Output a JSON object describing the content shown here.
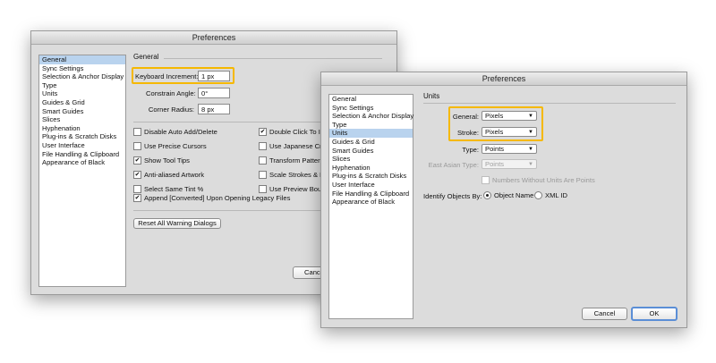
{
  "general_dialog": {
    "title": "Preferences",
    "categories": [
      "General",
      "Sync Settings",
      "Selection & Anchor Display",
      "Type",
      "Units",
      "Guides & Grid",
      "Smart Guides",
      "Slices",
      "Hyphenation",
      "Plug-ins & Scratch Disks",
      "User Interface",
      "File Handling & Clipboard",
      "Appearance of Black"
    ],
    "selected_category": "General",
    "section_title": "General",
    "keyboard_increment_label": "Keyboard Increment:",
    "keyboard_increment_value": "1 px",
    "constrain_angle_label": "Constrain Angle:",
    "constrain_angle_value": "0°",
    "corner_radius_label": "Corner Radius:",
    "corner_radius_value": "8 px",
    "options_left": [
      {
        "label": "Disable Auto Add/Delete",
        "checked": false
      },
      {
        "label": "Use Precise Cursors",
        "checked": false
      },
      {
        "label": "Show Tool Tips",
        "checked": true
      },
      {
        "label": "Anti-aliased Artwork",
        "checked": true
      },
      {
        "label": "Select Same Tint %",
        "checked": false
      }
    ],
    "options_right": [
      {
        "label": "Double Click To Is",
        "checked": true
      },
      {
        "label": "Use Japanese Crop",
        "checked": false
      },
      {
        "label": "Transform Pattern",
        "checked": false
      },
      {
        "label": "Scale Strokes & Ef",
        "checked": false
      },
      {
        "label": "Use Preview Bound",
        "checked": false
      }
    ],
    "append_option": {
      "label": "Append [Converted] Upon Opening Legacy Files",
      "checked": true
    },
    "reset_button": "Reset All Warning Dialogs",
    "cancel_button": "Cance"
  },
  "units_dialog": {
    "title": "Preferences",
    "categories": [
      "General",
      "Sync Settings",
      "Selection & Anchor Display",
      "Type",
      "Units",
      "Guides & Grid",
      "Smart Guides",
      "Slices",
      "Hyphenation",
      "Plug-ins & Scratch Disks",
      "User Interface",
      "File Handling & Clipboard",
      "Appearance of Black"
    ],
    "selected_category": "Units",
    "section_title": "Units",
    "general_label": "General:",
    "general_value": "Pixels",
    "stroke_label": "Stroke:",
    "stroke_value": "Pixels",
    "type_label": "Type:",
    "type_value": "Points",
    "east_asian_label": "East Asian Type:",
    "east_asian_value": "Points",
    "numbers_option": "Numbers Without Units Are Points",
    "identify_label": "Identify Objects By:",
    "radio_object_name": "Object Name",
    "radio_xml_id": "XML ID",
    "cancel_button": "Cancel",
    "ok_button": "OK"
  },
  "colors": {
    "highlight": "#f5b800",
    "selection": "#b9d3ee",
    "ok_border": "#5b8ed6"
  },
  "icons": {
    "check": "✔",
    "dropdown": "▼"
  }
}
